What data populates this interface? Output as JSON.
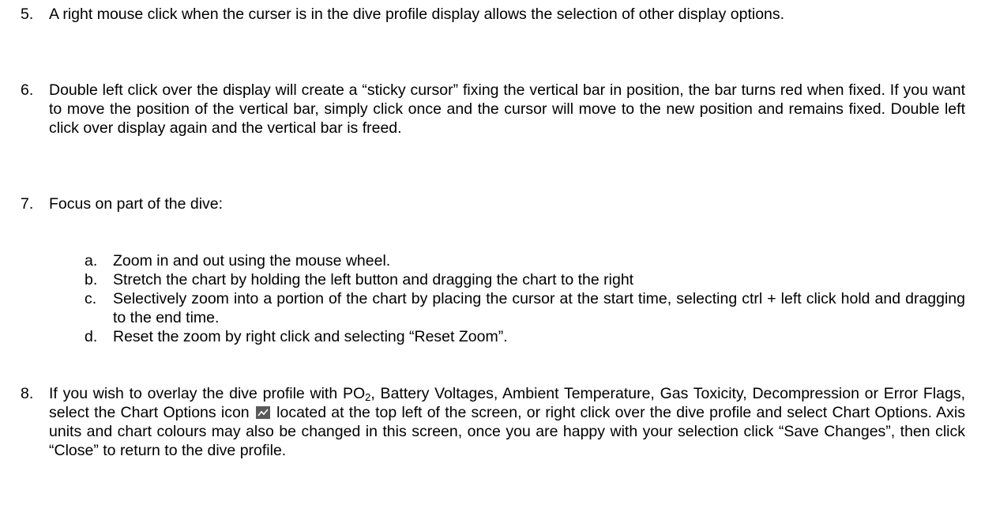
{
  "items": [
    {
      "number": "5.",
      "text": "A right mouse click when the curser is in the dive profile display allows the selection of other display options."
    },
    {
      "number": "6.",
      "text": "Double left click over the display will create a “sticky cursor” fixing the vertical bar in position, the bar turns red when fixed. If you want to move the position of the vertical bar, simply click once and the cursor will move to the new position and remains fixed. Double left click over display again and the vertical bar is freed."
    },
    {
      "number": "7.",
      "text": "Focus on part of the dive:",
      "subitems": [
        {
          "letter": "a.",
          "text": "Zoom in and out using the mouse wheel."
        },
        {
          "letter": "b.",
          "text": "Stretch the chart by holding the left button and dragging the chart to the right"
        },
        {
          "letter": "c.",
          "text": "Selectively zoom into a portion of the chart by placing the cursor at the start time, selecting ctrl + left click hold and dragging to the end time."
        },
        {
          "letter": "d.",
          "text": "Reset the zoom by right click and selecting “Reset Zoom”."
        }
      ]
    },
    {
      "number": "8.",
      "text_part1": "If you wish to overlay the dive profile with PO",
      "text_sub": "2",
      "text_part2": ", Battery Voltages, Ambient Temperature, Gas Toxicity, Decompression or Error Flags, select the Chart Options icon",
      "icon": "chart-options-icon",
      "text_part3": "located at the top left of the screen, or right click over the dive profile and select Chart Options. Axis units and chart colours may also be changed in this screen, once you are happy with your selection click “Save Changes”, then click “Close” to return to the dive profile."
    }
  ],
  "colors": {
    "text": "#000000",
    "icon_bg": "#5a5a5a",
    "icon_line": "#ffffff"
  }
}
